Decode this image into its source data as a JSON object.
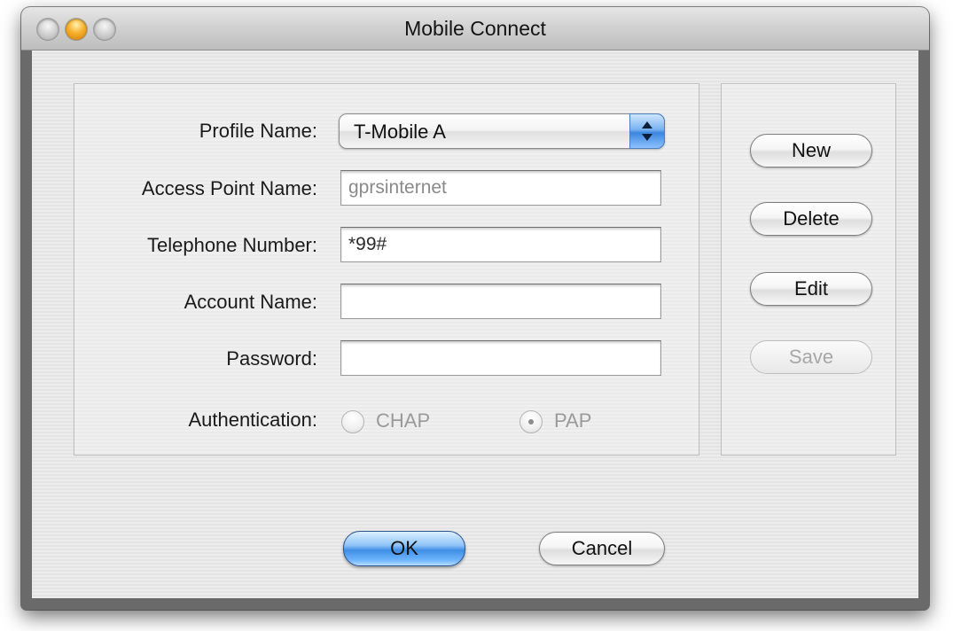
{
  "window": {
    "title": "Mobile Connect"
  },
  "form": {
    "profile_name_label": "Profile Name:",
    "profile_name_value": "T-Mobile A",
    "apn_label": "Access Point Name:",
    "apn_value": "gprsinternet",
    "phone_label": "Telephone Number:",
    "phone_value": "*99#",
    "account_label": "Account Name:",
    "account_value": "",
    "password_label": "Password:",
    "password_value": "",
    "auth_label": "Authentication:",
    "auth_options": [
      {
        "label": "CHAP",
        "selected": false,
        "enabled": false
      },
      {
        "label": "PAP",
        "selected": true,
        "enabled": false
      }
    ]
  },
  "side_buttons": {
    "new_label": "New",
    "delete_label": "Delete",
    "edit_label": "Edit",
    "save_label": "Save",
    "save_enabled": false
  },
  "footer": {
    "ok_label": "OK",
    "cancel_label": "Cancel"
  },
  "icons": {
    "close": "close-button-icon",
    "minimize": "minimize-button-icon",
    "zoom": "zoom-button-icon",
    "popup": "chevron-up-down-icon",
    "radio": "radio-button-icon"
  },
  "colors": {
    "default_button": "#3f8fe4",
    "minimize_button": "#f7b12c",
    "disabled_text": "#a7a7a7"
  }
}
